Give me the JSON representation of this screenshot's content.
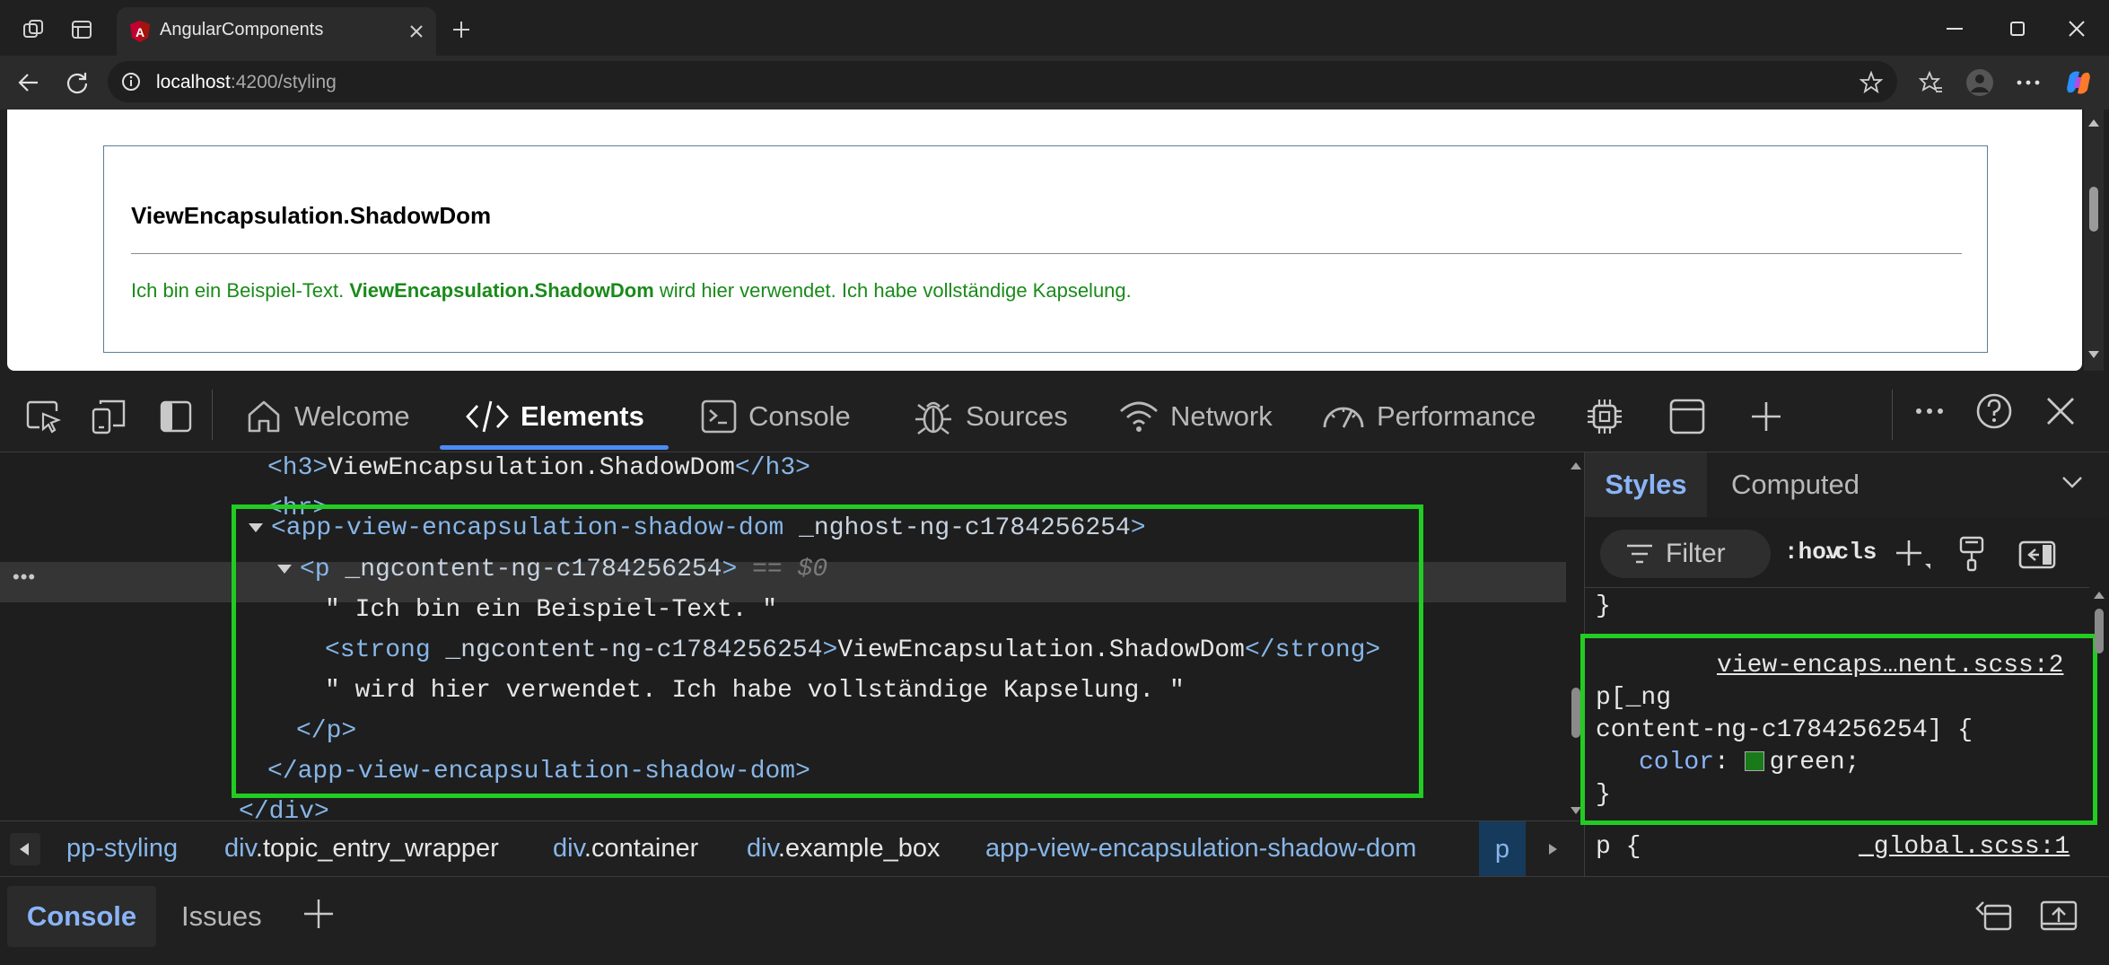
{
  "browser": {
    "tab_title": "AngularComponents",
    "url_host": "localhost",
    "url_rest": ":4200/styling"
  },
  "page": {
    "heading": "ViewEncapsulation.ShadowDom",
    "text_before": "Ich bin ein Beispiel-Text. ",
    "text_strong": "ViewEncapsulation.ShadowDom",
    "text_after": " wird hier verwendet. Ich habe vollständige Kapselung.",
    "text_color": "#1a8a1a"
  },
  "devtools": {
    "tabs": [
      {
        "label": "Welcome",
        "icon": "home-icon"
      },
      {
        "label": "Elements",
        "icon": "code-icon"
      },
      {
        "label": "Console",
        "icon": "console-icon"
      },
      {
        "label": "Sources",
        "icon": "bug-icon"
      },
      {
        "label": "Network",
        "icon": "wifi-icon"
      },
      {
        "label": "Performance",
        "icon": "gauge-icon"
      }
    ],
    "dom": {
      "h3_open": "<h3>",
      "h3_text": "ViewEncapsulation.ShadowDom",
      "h3_close": "</h3>",
      "hr": "<hr>",
      "host_tag": "<app-view-encapsulation-shadow-dom",
      "host_attr": " _nghost-ng-c1784256254",
      "host_end": ">",
      "p_tag": "<p",
      "p_attr": " _ngcontent-ng-c1784256254",
      "p_end": ">",
      "p_ref": "== $0",
      "text1": "\" Ich bin ein Beispiel-Text. \"",
      "strong_open": "<strong",
      "strong_attr": " _ngcontent-ng-c1784256254",
      "strong_open_end": ">",
      "strong_text": "ViewEncapsulation.ShadowDom",
      "strong_close": "</strong>",
      "text2": "\" wird hier verwendet. Ich habe vollständige Kapselung. \"",
      "p_close": "</p>",
      "host_close": "</app-view-encapsulation-shadow-dom>",
      "cut_line": "</div>",
      "row_menu": "•••"
    },
    "breadcrumbs": [
      {
        "tag": "pp-styling",
        "cls": ""
      },
      {
        "tag": "div",
        "cls": ".topic_entry_wrapper"
      },
      {
        "tag": "div",
        "cls": ".container"
      },
      {
        "tag": "div",
        "cls": ".example_box"
      },
      {
        "tag": "app-view-encapsulation-shadow-dom",
        "cls": ""
      },
      {
        "tag": "p",
        "cls": ""
      }
    ],
    "styles": {
      "tab_styles": "Styles",
      "tab_computed": "Computed",
      "filter": "Filter",
      "hov": ":hov",
      "cls": ".cls",
      "prev_close": "}",
      "rule1_source": "view-encaps…nent.scss:2",
      "rule1_sel1": "p[_ng",
      "rule1_sel2": "content-ng-c1784256254] {",
      "rule1_prop": "color",
      "rule1_colon": ":",
      "rule1_value": "green;",
      "rule1_close": "}",
      "rule2_sel": "p {",
      "rule2_source": "_global.scss:1"
    },
    "drawer": {
      "console": "Console",
      "issues": "Issues"
    }
  }
}
